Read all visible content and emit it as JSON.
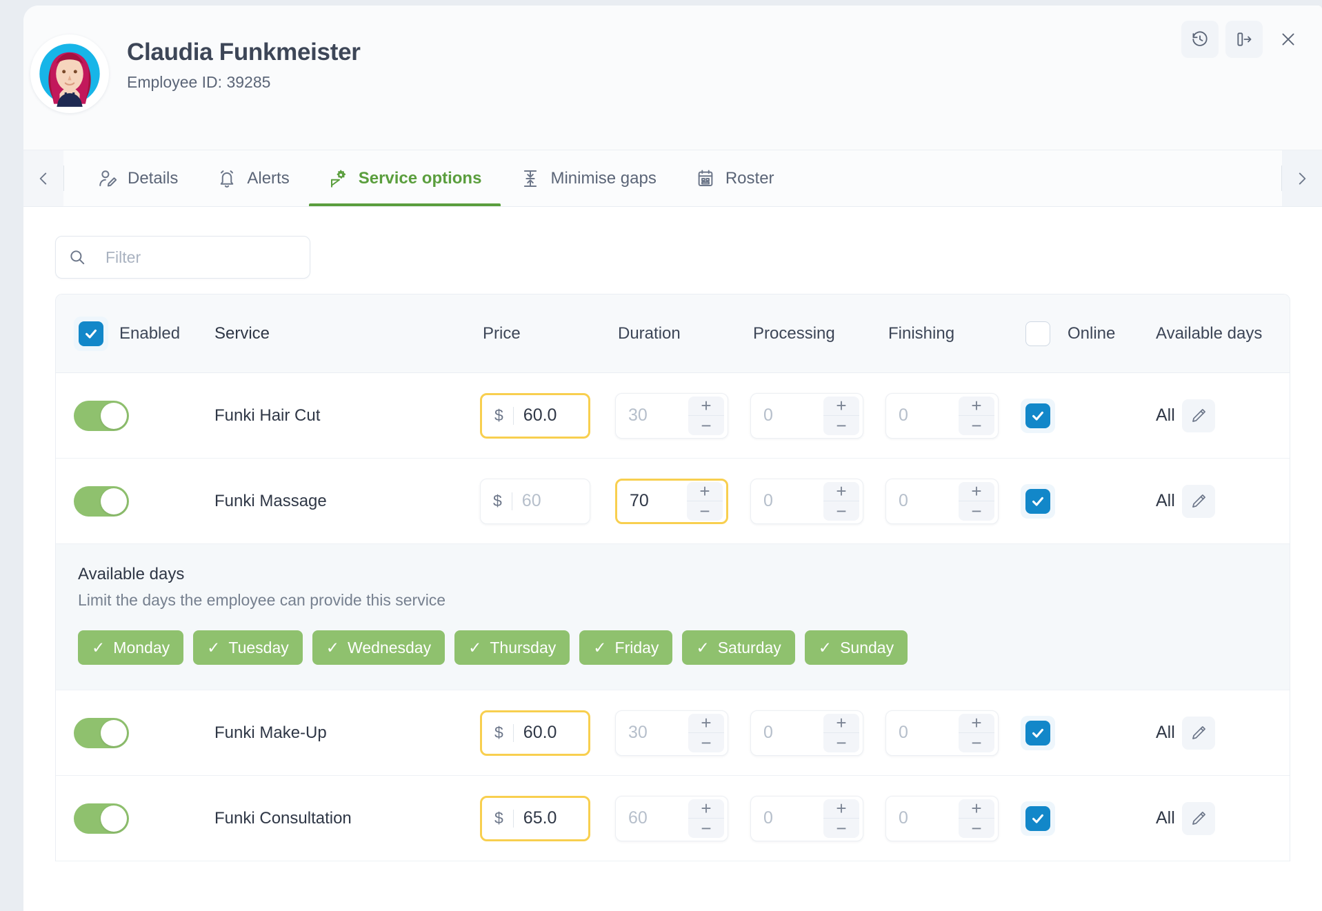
{
  "header": {
    "name": "Claudia Funkmeister",
    "employee_id_label": "Employee ID: 39285",
    "avatar_icon": "avatar-illustration",
    "actions": [
      {
        "name": "history-button",
        "icon": "history-clock-icon"
      },
      {
        "name": "expand-panel-button",
        "icon": "panel-expand-right-icon"
      },
      {
        "name": "close-button",
        "icon": "close-x-icon"
      }
    ]
  },
  "tabbar": {
    "prev_icon": "chevron-left-icon",
    "next_icon": "chevron-right-icon",
    "tabs": [
      {
        "label": "Details",
        "icon": "user-edit-icon",
        "active": false
      },
      {
        "label": "Alerts",
        "icon": "bell-alert-icon",
        "active": false
      },
      {
        "label": "Service options",
        "icon": "gear-service-icon",
        "active": true
      },
      {
        "label": "Minimise gaps",
        "icon": "collapse-gaps-icon",
        "active": false
      },
      {
        "label": "Roster",
        "icon": "calendar-icon",
        "active": false
      }
    ],
    "active_color": "#5a9e3d"
  },
  "search": {
    "placeholder": "Filter",
    "value": "",
    "icon": "search-icon"
  },
  "table": {
    "columns": {
      "enabled": "Enabled",
      "service": "Service",
      "price": "Price",
      "duration": "Duration",
      "processing": "Processing",
      "finishing": "Finishing",
      "online": "Online",
      "available_days": "Available days"
    },
    "header_enabled_checked": true,
    "header_online_checked": false,
    "rows": [
      {
        "service": "Funki Hair Cut",
        "enabled": true,
        "currency": "$",
        "price_value": "60.0",
        "price_is_placeholder": false,
        "price_highlighted": true,
        "duration_value": "30",
        "duration_is_placeholder": true,
        "duration_highlighted": false,
        "processing_value": "0",
        "finishing_value": "0",
        "online": true,
        "available_days": "All",
        "edit_icon": "pencil-icon",
        "expanded": false
      },
      {
        "service": "Funki Massage",
        "enabled": true,
        "currency": "$",
        "price_value": "60",
        "price_is_placeholder": true,
        "price_highlighted": false,
        "duration_value": "70",
        "duration_is_placeholder": false,
        "duration_highlighted": true,
        "processing_value": "0",
        "finishing_value": "0",
        "online": true,
        "available_days": "All",
        "edit_icon": "pencil-icon",
        "expanded": true
      },
      {
        "service": "Funki Make-Up",
        "enabled": true,
        "currency": "$",
        "price_value": "60.0",
        "price_is_placeholder": false,
        "price_highlighted": true,
        "duration_value": "30",
        "duration_is_placeholder": true,
        "duration_highlighted": false,
        "processing_value": "0",
        "finishing_value": "0",
        "online": true,
        "available_days": "All",
        "edit_icon": "pencil-icon",
        "expanded": false
      },
      {
        "service": "Funki Consultation",
        "enabled": true,
        "currency": "$",
        "price_value": "65.0",
        "price_is_placeholder": false,
        "price_highlighted": true,
        "duration_value": "60",
        "duration_is_placeholder": true,
        "duration_highlighted": false,
        "processing_value": "0",
        "finishing_value": "0",
        "online": true,
        "available_days": "All",
        "edit_icon": "pencil-icon",
        "expanded": false
      }
    ],
    "stepper_increment": "+",
    "stepper_decrement": "−"
  },
  "days_panel": {
    "title": "Available days",
    "subtitle": "Limit the days the employee can provide this service",
    "tick": "✓",
    "days": [
      {
        "label": "Monday",
        "selected": true
      },
      {
        "label": "Tuesday",
        "selected": true
      },
      {
        "label": "Wednesday",
        "selected": true
      },
      {
        "label": "Thursday",
        "selected": true
      },
      {
        "label": "Friday",
        "selected": true
      },
      {
        "label": "Saturday",
        "selected": true
      },
      {
        "label": "Sunday",
        "selected": true
      }
    ]
  },
  "colors": {
    "accent_green": "#5a9e3d",
    "toggle_green": "#8fc16e",
    "checkbox_blue": "#1287c9",
    "highlight_yellow": "#f8cf4f",
    "text_dark": "#2f3746",
    "text_muted": "#76808f"
  }
}
